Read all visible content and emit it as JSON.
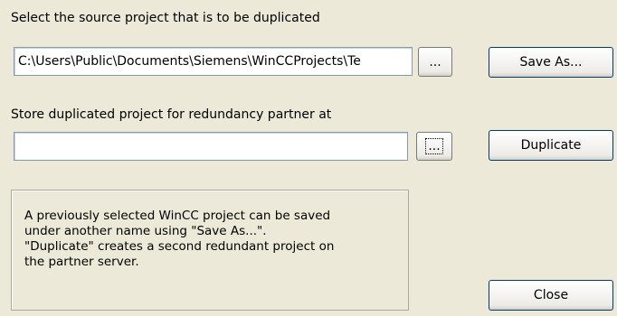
{
  "source": {
    "label": "Select the source project that is to be duplicated",
    "path_value": "C:\\Users\\Public\\Documents\\Siemens\\WinCCProjects\\Te",
    "browse_label": "...",
    "save_as_label": "Save As..."
  },
  "target": {
    "label": "Store duplicated project for redundancy partner at",
    "path_value": "",
    "browse_label": "...",
    "duplicate_label": "Duplicate"
  },
  "info": {
    "text": "A previously selected WinCC project can be saved\nunder another name using \"Save As...\".\n\"Duplicate\" creates a second redundant project on\nthe partner server."
  },
  "footer": {
    "close_label": "Close"
  }
}
